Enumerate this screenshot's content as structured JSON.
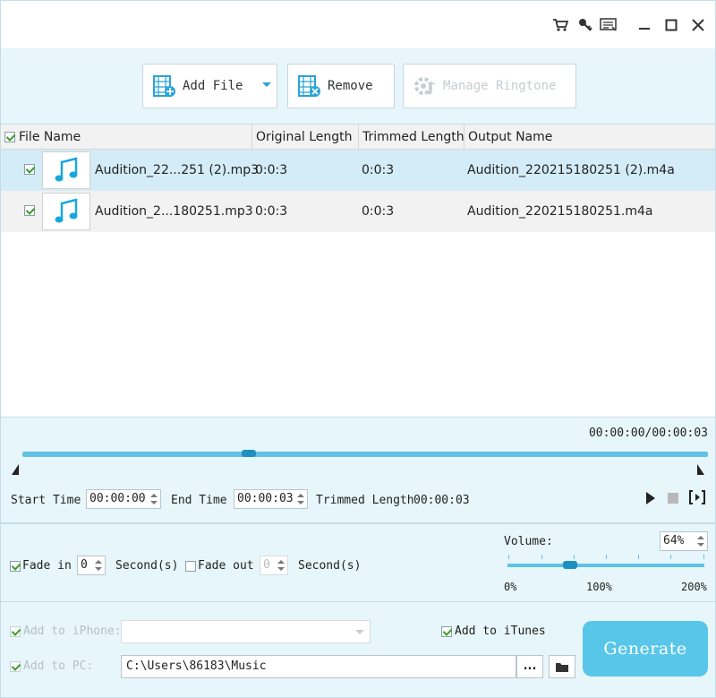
{
  "toolbar": {
    "add_file": "Add File",
    "remove": "Remove",
    "manage_ringtone": "Manage Ringtone"
  },
  "list": {
    "headers": {
      "file_name": "File Name",
      "original_length": "Original Length",
      "trimmed_length": "Trimmed Length",
      "output_name": "Output Name"
    },
    "rows": [
      {
        "file_name": "Audition_22...251 (2).mp3",
        "original_length": "0:0:3",
        "trimmed_length": "0:0:3",
        "output_name": "Audition_220215180251 (2).m4a",
        "checked": true
      },
      {
        "file_name": "Audition_2...180251.mp3",
        "original_length": "0:0:3",
        "trimmed_length": "0:0:3",
        "output_name": "Audition_220215180251.m4a",
        "checked": true
      }
    ]
  },
  "trim": {
    "time_display": "00:00:00/00:00:03",
    "start_time_label": "Start Time",
    "start_time_value": "00:00:00",
    "end_time_label": "End Time",
    "end_time_value": "00:00:03",
    "trimmed_length_label": "Trimmed Length",
    "trimmed_length_value": "00:00:03"
  },
  "fade": {
    "fade_in_label": "Fade in",
    "fade_in_value": "0",
    "fade_in_unit": "Second(s)",
    "fade_in_checked": true,
    "fade_out_label": "Fade out",
    "fade_out_value": "0",
    "fade_out_unit": "Second(s)",
    "fade_out_checked": false,
    "volume_label": "Volume:",
    "volume_value": "64%",
    "volume_min": "0%",
    "volume_mid": "100%",
    "volume_max": "200%"
  },
  "output": {
    "add_to_iphone_label": "Add to iPhone:",
    "add_to_itunes_label": "Add to iTunes",
    "add_to_pc_label": "Add to PC:",
    "pc_path": "C:\\Users\\86183\\Music",
    "browse_label": "...",
    "generate": "Generate"
  },
  "colors": {
    "accent": "#58c6e8",
    "panel_bg": "#e7f6fb",
    "selected_row": "#d3ecf7"
  }
}
